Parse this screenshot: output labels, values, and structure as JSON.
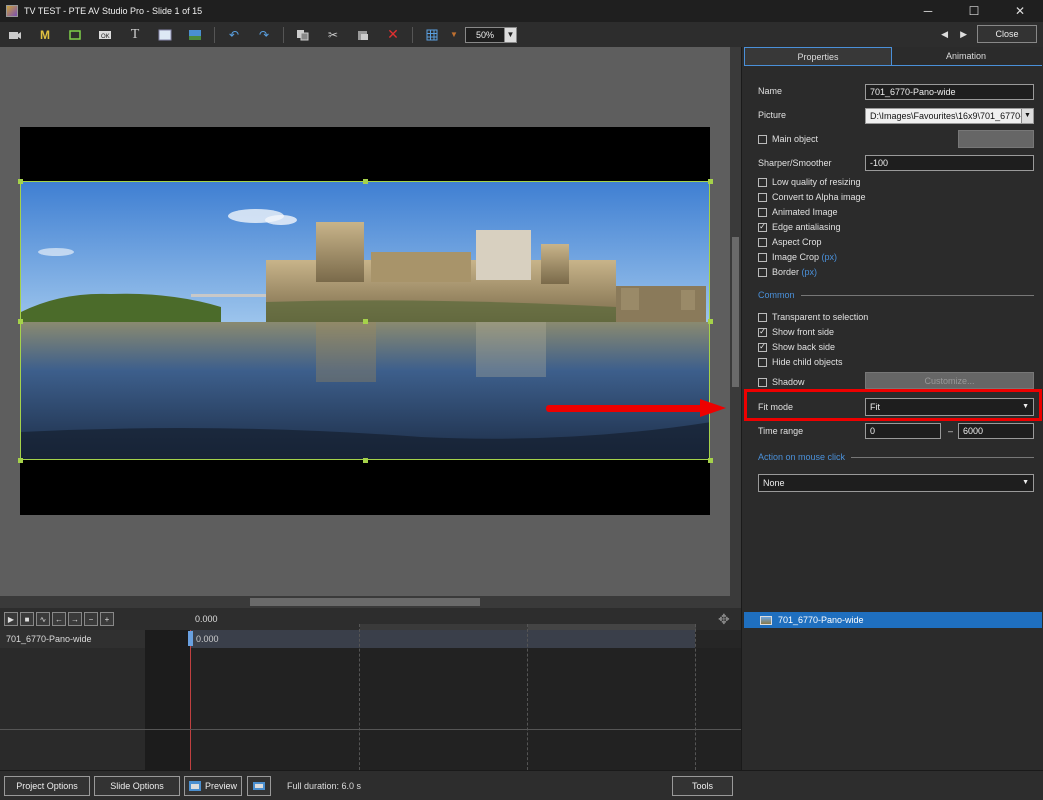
{
  "window": {
    "title": "TV TEST - PTE AV Studio Pro - Slide 1 of 15",
    "minimize": "─",
    "maximize": "☐",
    "close": "✕"
  },
  "toolbar": {
    "zoom": "50%",
    "close_label": "Close",
    "prev": "◀",
    "next": "▶",
    "icons": [
      "camera-icon",
      "m-icon",
      "frame-icon",
      "ok-icon",
      "text-icon",
      "rectangle-icon",
      "image-icon",
      "undo-icon",
      "redo-icon",
      "copy-icon",
      "cut-icon",
      "paste-icon",
      "delete-icon",
      "grid-icon",
      "grid-dropdown-icon"
    ]
  },
  "props": {
    "tabs": [
      "Properties",
      "Animation"
    ],
    "name_label": "Name",
    "name_value": "701_6770-Pano-wide",
    "picture_label": "Picture",
    "picture_value": "D:\\Images\\Favourites\\16x9\\701_6770-Pa",
    "main_object": "Main object",
    "sharper_label": "Sharper/Smoother",
    "sharper_value": "-100",
    "low_quality": "Low quality of resizing",
    "convert_alpha": "Convert to Alpha image",
    "animated_image": "Animated Image",
    "edge_antialiasing": "Edge antialiasing",
    "aspect_crop": "Aspect Crop",
    "image_crop": "Image Crop",
    "image_crop_unit": "(px)",
    "border": "Border",
    "border_unit": "(px)",
    "common_section": "Common",
    "transparent": "Transparent to selection",
    "show_front": "Show front side",
    "show_back": "Show back side",
    "hide_child": "Hide child objects",
    "shadow": "Shadow",
    "customize": "Customize...",
    "fit_mode_label": "Fit mode",
    "fit_mode_value": "Fit",
    "time_range_label": "Time range",
    "time_start": "0",
    "time_dash": "–",
    "time_end": "6000",
    "action_section": "Action on mouse click",
    "action_value": "None"
  },
  "timeline": {
    "time0": "0.000",
    "track_name": "701_6770-Pano-wide",
    "track_time": "0.000"
  },
  "objects": {
    "selected": "701_6770-Pano-wide"
  },
  "bottom": {
    "project_options": "Project Options",
    "slide_options": "Slide Options",
    "preview": "Preview",
    "full_duration": "Full duration: 6.0 s",
    "tools": "Tools"
  }
}
